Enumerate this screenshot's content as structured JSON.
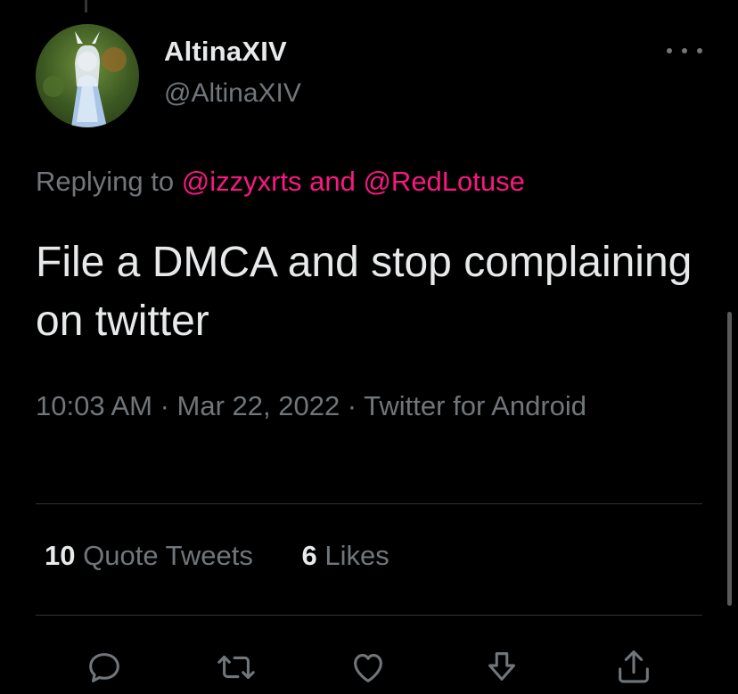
{
  "tweet": {
    "display_name": "AltinaXIV",
    "handle": "@AltinaXIV",
    "replying_prefix": "Replying to",
    "replying_mentions": "@izzyxrts and @RedLotuse",
    "text": "File a DMCA and stop complaining on twitter",
    "timestamp_line": "10:03 AM · Mar 22, 2022 · Twitter for Android"
  },
  "stats": {
    "quote_tweets_count": "10",
    "quote_tweets_label": "Quote Tweets",
    "likes_count": "6",
    "likes_label": "Likes"
  },
  "colors": {
    "background": "#000000",
    "text_primary": "#e7e9ea",
    "text_secondary": "#71767b",
    "mention": "#f91880",
    "divider": "#2f3336"
  },
  "icons": {
    "more": "more-horizontal-icon",
    "reply": "reply-icon",
    "retweet": "retweet-icon",
    "like": "like-icon",
    "bookmark": "bookmark-icon",
    "share": "share-icon"
  }
}
